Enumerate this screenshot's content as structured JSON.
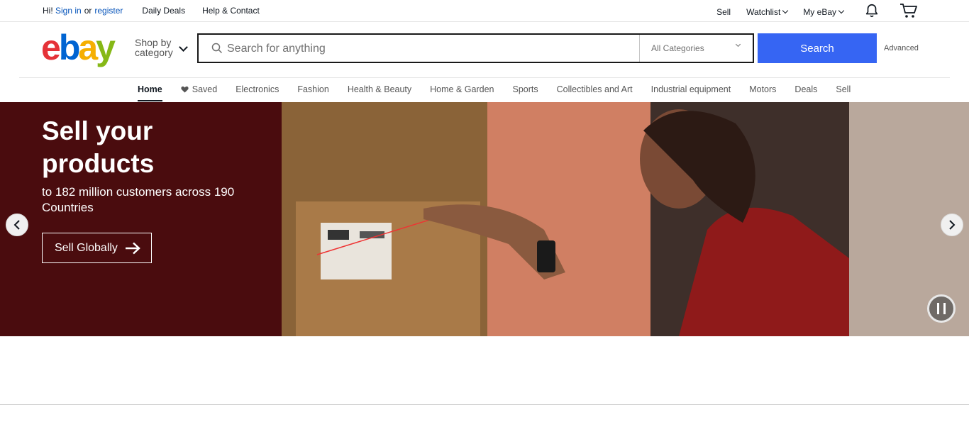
{
  "topbar": {
    "greeting": "Hi!",
    "sign_in": "Sign in",
    "or": "or",
    "register": "register",
    "daily_deals": "Daily Deals",
    "help_contact": "Help & Contact",
    "sell": "Sell",
    "watchlist": "Watchlist",
    "my_ebay": "My eBay",
    "notification_icon": "bell-icon",
    "cart_icon": "cart-icon"
  },
  "header": {
    "logo": {
      "e": "e",
      "b": "b",
      "a": "a",
      "y": "y"
    },
    "logo_colors": {
      "e": "#e53238",
      "b": "#0064d2",
      "a": "#f5af02",
      "y": "#86b817"
    },
    "shop_by_line1": "Shop by",
    "shop_by_line2": "category",
    "search_placeholder": "Search for anything",
    "search_value": "",
    "category_selected": "All Categories",
    "search_button": "Search",
    "search_button_color": "#3665f3",
    "advanced": "Advanced"
  },
  "nav": {
    "items": [
      {
        "label": "Home",
        "active": true
      },
      {
        "label": "Saved",
        "icon": "heart-icon"
      },
      {
        "label": "Electronics"
      },
      {
        "label": "Fashion"
      },
      {
        "label": "Health & Beauty"
      },
      {
        "label": "Home & Garden"
      },
      {
        "label": "Sports"
      },
      {
        "label": "Collectibles and Art"
      },
      {
        "label": "Industrial equipment"
      },
      {
        "label": "Motors"
      },
      {
        "label": "Deals"
      },
      {
        "label": "Sell"
      }
    ]
  },
  "banner": {
    "title": "Sell your products",
    "subtitle": "to 182 million customers across 190 Countries",
    "cta": "Sell Globally",
    "background_color": "#4a0c0e"
  }
}
